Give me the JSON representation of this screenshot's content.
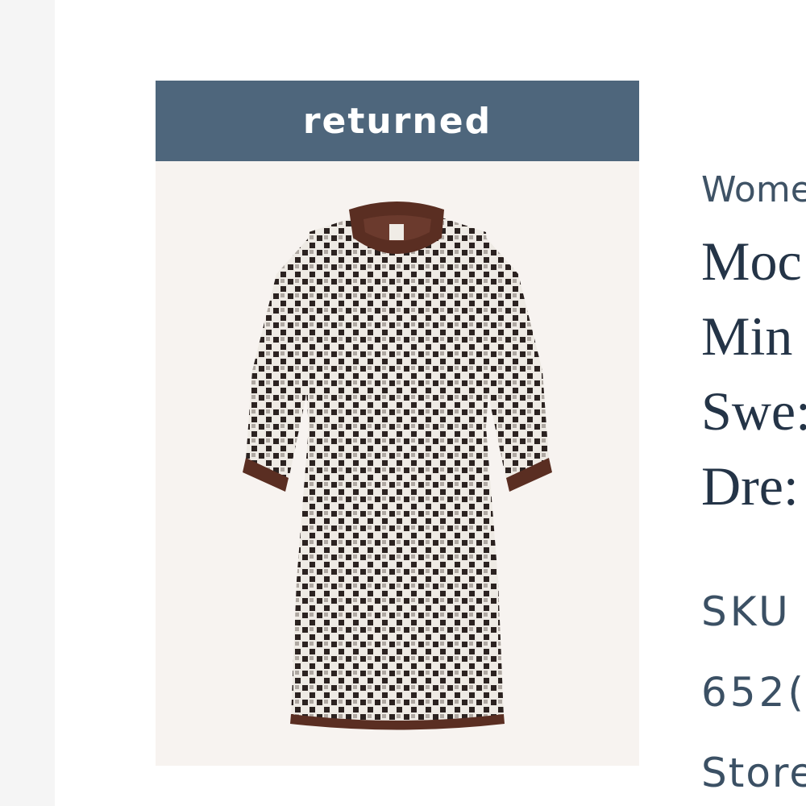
{
  "item": {
    "status": "returned",
    "category": "Wome",
    "title_lines": [
      "Moc",
      "Min",
      "Swe:",
      "Dre:"
    ],
    "sku_label": "SKU",
    "sku_value": "652(",
    "store_label": "Store"
  },
  "image": {
    "subject": "checkered knit mini sweater dress with brown trim",
    "colors": {
      "banner": "#4e667c",
      "dress_pattern_dark": "#2b2220",
      "dress_pattern_light": "#eeeae4",
      "trim": "#5a2e22",
      "background": "#f7f3f0"
    }
  }
}
